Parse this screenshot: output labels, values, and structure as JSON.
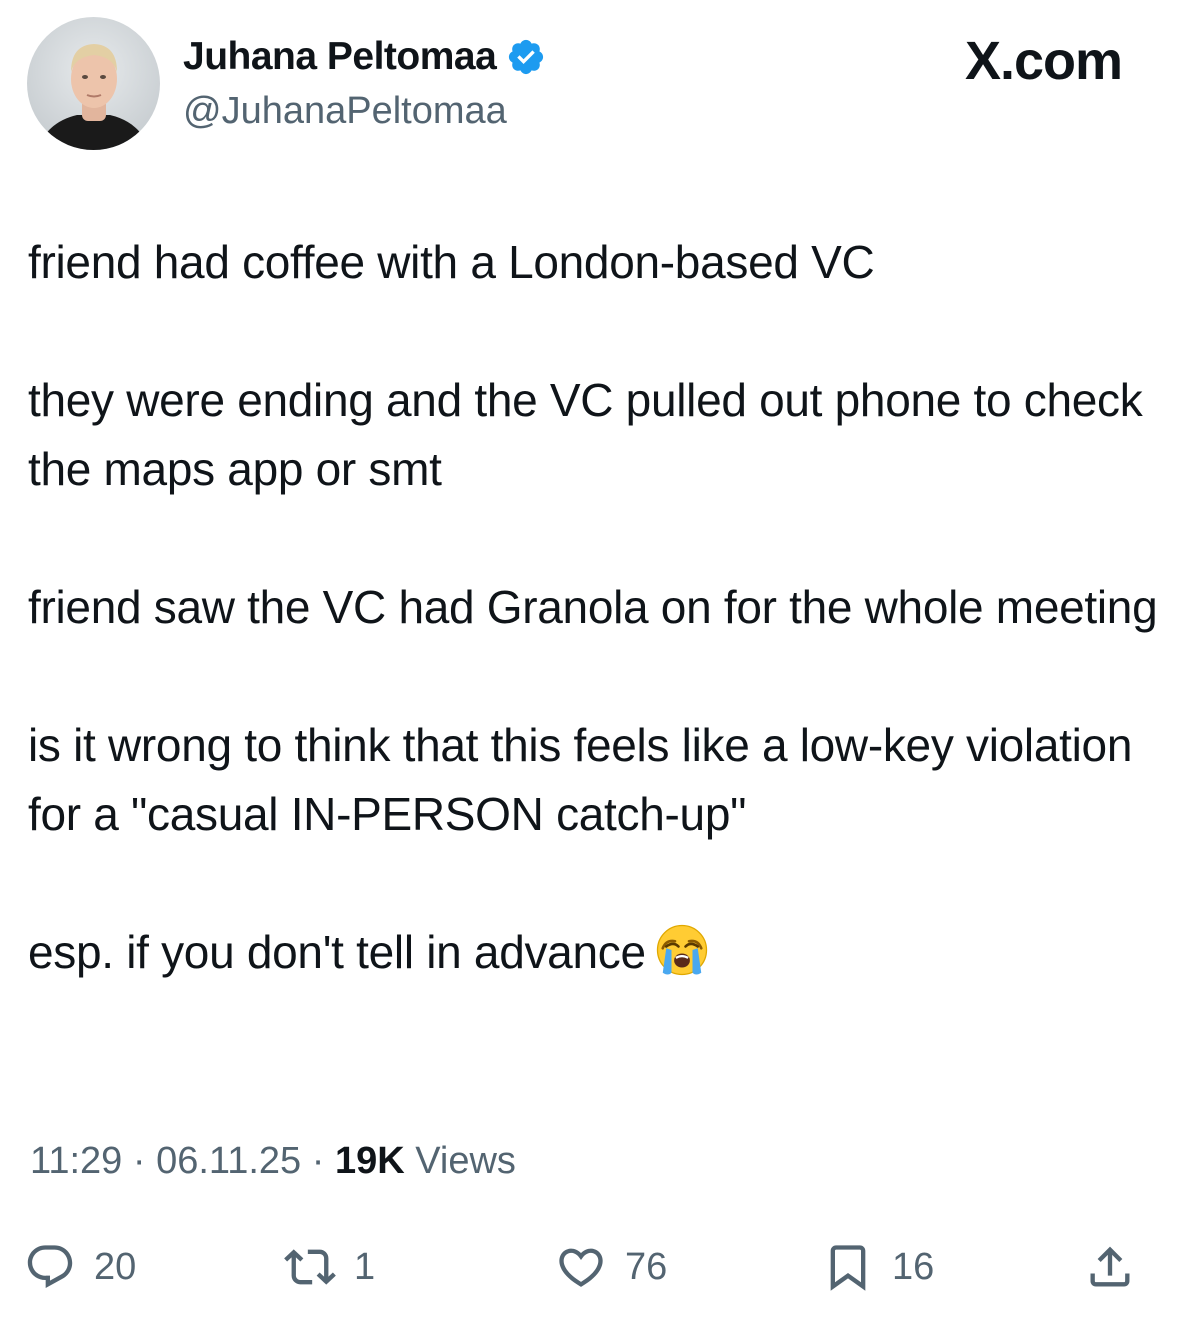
{
  "author": {
    "name": "Juhana Peltomaa",
    "handle": "@JuhanaPeltomaa",
    "avatar_icon": "profile-photo",
    "verified_icon": "verified-badge-icon",
    "verified_color": "#1d9bf0"
  },
  "brand": {
    "label": "X.com"
  },
  "tweet": {
    "paragraphs": [
      "friend had coffee with a London-based VC",
      "they were ending and the VC pulled out phone to check the maps app or smt",
      "friend saw the VC had Granola on for the whole meeting",
      "is it wrong to think that this feels like a low-key violation for a \"casual IN-PERSON catch-up\"",
      "esp. if you don't tell in advance"
    ],
    "emoji_icon": "loudly-crying-face-emoji"
  },
  "meta": {
    "time": "11:29",
    "separator": " · ",
    "date": "06.11.25",
    "views_count": "19K",
    "views_label": " Views"
  },
  "actions": {
    "reply": {
      "icon": "reply-icon",
      "count": "20"
    },
    "retweet": {
      "icon": "retweet-icon",
      "count": "1"
    },
    "like": {
      "icon": "heart-icon",
      "count": "76"
    },
    "bookmark": {
      "icon": "bookmark-icon",
      "count": "16"
    },
    "share": {
      "icon": "share-icon"
    }
  },
  "colors": {
    "text_primary": "#0f1419",
    "text_secondary": "#536471",
    "accent": "#1d9bf0"
  }
}
